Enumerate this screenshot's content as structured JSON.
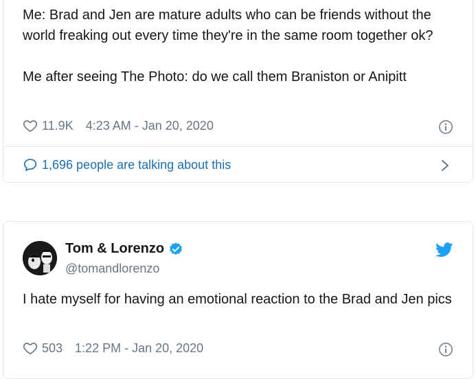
{
  "tweet1": {
    "text": "Me: Brad and Jen are mature adults who can be friends without the world freaking out every time they're in the same room together ok?\n\nMe after seeing The Photo: do we call them Braniston or Anipitt",
    "likes": "11.9K",
    "timestamp": "4:23 AM - Jan 20, 2020",
    "talking": "1,696 people are talking about this",
    "icons": {
      "like": "heart-icon",
      "info": "info-icon",
      "talking": "speech-bubble-icon",
      "chevron": "chevron-right-icon"
    }
  },
  "tweet2": {
    "name": "Tom & Lorenzo",
    "handle": "@tomandlorenzo",
    "text": "I hate myself for having an emotional reaction to the Brad and Jen pics",
    "likes": "503",
    "timestamp": "1:22 PM - Jan 20, 2020",
    "icons": {
      "verified": "verified-badge-icon",
      "platform": "twitter-bird-icon",
      "like": "heart-icon",
      "info": "info-icon"
    }
  },
  "colors": {
    "text": "#14171a",
    "muted": "#657786",
    "link": "#1b6fb5",
    "twitter_blue": "#1da1f2",
    "border": "#e1e8ed"
  }
}
